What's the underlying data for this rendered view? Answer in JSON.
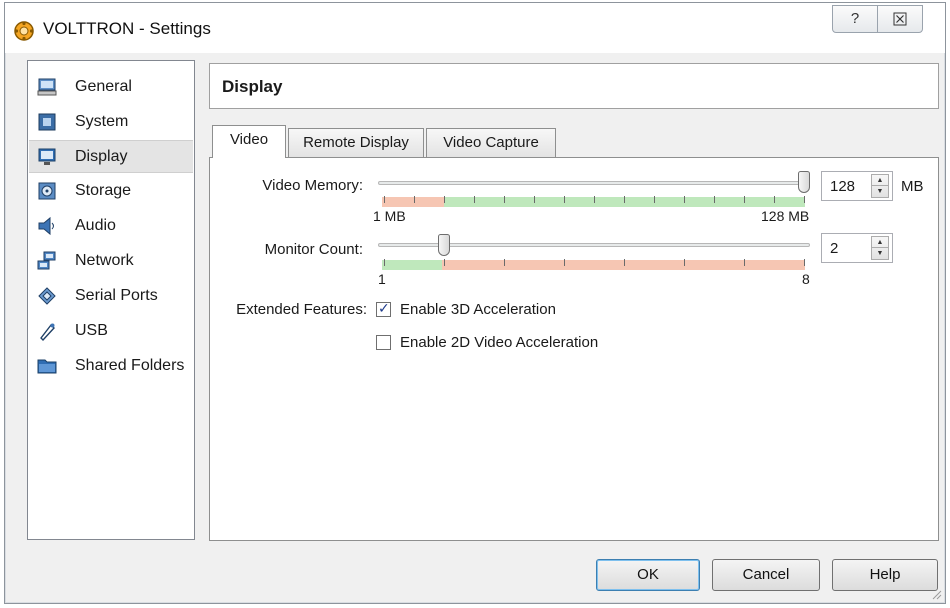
{
  "window": {
    "title": "VOLTTRON - Settings",
    "help_glyph": "?",
    "close_glyph": "☒"
  },
  "sidebar": {
    "items": [
      {
        "label": "General",
        "icon": "monitor-icon"
      },
      {
        "label": "System",
        "icon": "chip-icon"
      },
      {
        "label": "Display",
        "icon": "display-icon",
        "selected": true
      },
      {
        "label": "Storage",
        "icon": "disk-icon"
      },
      {
        "label": "Audio",
        "icon": "speaker-icon"
      },
      {
        "label": "Network",
        "icon": "network-icon"
      },
      {
        "label": "Serial Ports",
        "icon": "serial-port-icon"
      },
      {
        "label": "USB",
        "icon": "usb-icon"
      },
      {
        "label": "Shared Folders",
        "icon": "folder-icon"
      }
    ]
  },
  "panel": {
    "title": "Display",
    "tabs": [
      {
        "label": "Video",
        "active": true
      },
      {
        "label": "Remote Display",
        "active": false
      },
      {
        "label": "Video Capture",
        "active": false
      }
    ],
    "video_memory": {
      "label": "Video Memory:",
      "value": "128",
      "unit": "MB",
      "min_label": "1 MB",
      "max_label": "128 MB",
      "slider_fraction": 1.0
    },
    "monitor_count": {
      "label": "Monitor Count:",
      "value": "2",
      "min_label": "1",
      "max_label": "8",
      "slider_fraction": 0.143
    },
    "extended_features": {
      "label": "Extended Features:",
      "enable_3d": {
        "label": "Enable 3D Acceleration",
        "checked": true
      },
      "enable_2d": {
        "label": "Enable 2D Video Acceleration",
        "checked": false
      }
    }
  },
  "footer": {
    "ok": "OK",
    "cancel": "Cancel",
    "help": "Help"
  },
  "colors": {
    "range_red": "#f6c6b3",
    "range_green": "#bfe8bc",
    "selection": "#e4e4e4"
  }
}
